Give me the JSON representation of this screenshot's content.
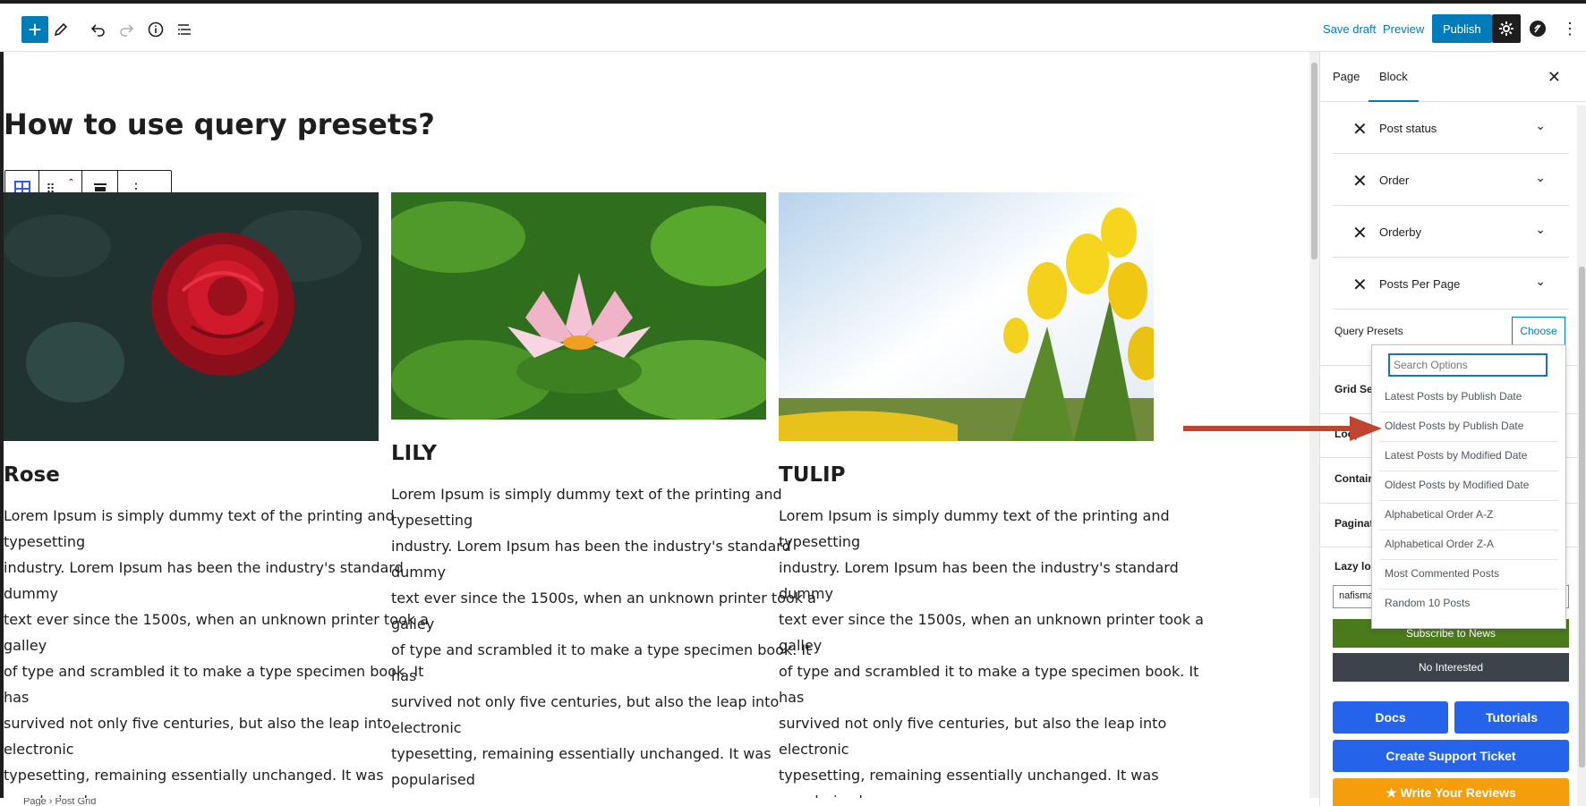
{
  "toolbar": {
    "add_label": "+",
    "save_draft": "Save draft",
    "preview": "Preview",
    "publish": "Publish"
  },
  "canvas": {
    "title": "How to use query presets?",
    "cards": [
      {
        "title": "Rose",
        "text": "Lorem Ipsum is simply dummy text of the printing and typesetting\nindustry. Lorem Ipsum has been the industry's standard dummy\ntext ever since the 1500s, when an unknown printer took a galley\nof type and scrambled it to make a type specimen book. It has\nsurvived not only five centuries, but also the leap into electronic\ntypesetting, remaining essentially unchanged. It was popularised\nin the 1960s with the release of Letraset sheets containing Lorem\nIpsum passages, and more recently with desktop publishing\nsoftware like Aldus PageMaker including versions of Lorem Ipsum."
      },
      {
        "title": "LILY",
        "text": "Lorem Ipsum is simply dummy text of the printing and typesetting\nindustry. Lorem Ipsum has been the industry's standard dummy\ntext ever since the 1500s, when an unknown printer took a galley\nof type and scrambled it to make a type specimen book. It has\nsurvived not only five centuries, but also the leap into electronic\ntypesetting, remaining essentially unchanged. It was popularised\nin the 1960s with the release of Letraset sheets containing Lorem\nIpsum passages, and more recently with desktop publishing\nsoftware like Aldus PageMaker including versions of Lorem Ipsum."
      },
      {
        "title": "TULIP",
        "text": "Lorem Ipsum is simply dummy text of the printing and typesetting\nindustry. Lorem Ipsum has been the industry's standard dummy\ntext ever since the 1500s, when an unknown printer took a galley\nof type and scrambled it to make a type specimen book. It has\nsurvived not only five centuries, but also the leap into electronic\ntypesetting, remaining essentially unchanged. It was popularised\nin the 1960s with the release of Letraset sheets containing Lorem\nIpsum passages, and more recently with desktop publishing\nsoftware like Aldus PageMaker including versions of Lorem Ipsum."
      }
    ],
    "breadcrumb": "Page  ›  Post Grid"
  },
  "sidebar": {
    "tabs": [
      "Page",
      "Block"
    ],
    "rows": [
      "Post status",
      "Order",
      "Orderby",
      "Posts Per Page"
    ],
    "query_presets_label": "Query Presets",
    "choose_label": "Choose",
    "background_rows": [
      "Grid Set",
      "Loop",
      "Contain",
      "Paginati",
      "Lazy loa"
    ],
    "input_value": "nafisma",
    "subscribe": "Subscribe to News",
    "not_interested": "No Interested",
    "docs": "Docs",
    "tutorials": "Tutorials",
    "support": "Create Support Ticket",
    "review": "★ Write Your Reviews"
  },
  "dropdown": {
    "search_placeholder": "Search Options",
    "options": [
      "Latest Posts by Publish Date",
      "Oldest Posts by Publish Date",
      "Latest Posts by Modified Date",
      "Oldest Posts by Modified Date",
      "Alphabetical Order A-Z",
      "Alphabetical Order Z-A",
      "Most Commented Posts",
      "Random 10 Posts"
    ]
  },
  "colors": {
    "accent": "#007cba",
    "subscribe": "#4a7a1a",
    "arrow": "#c0452e"
  }
}
